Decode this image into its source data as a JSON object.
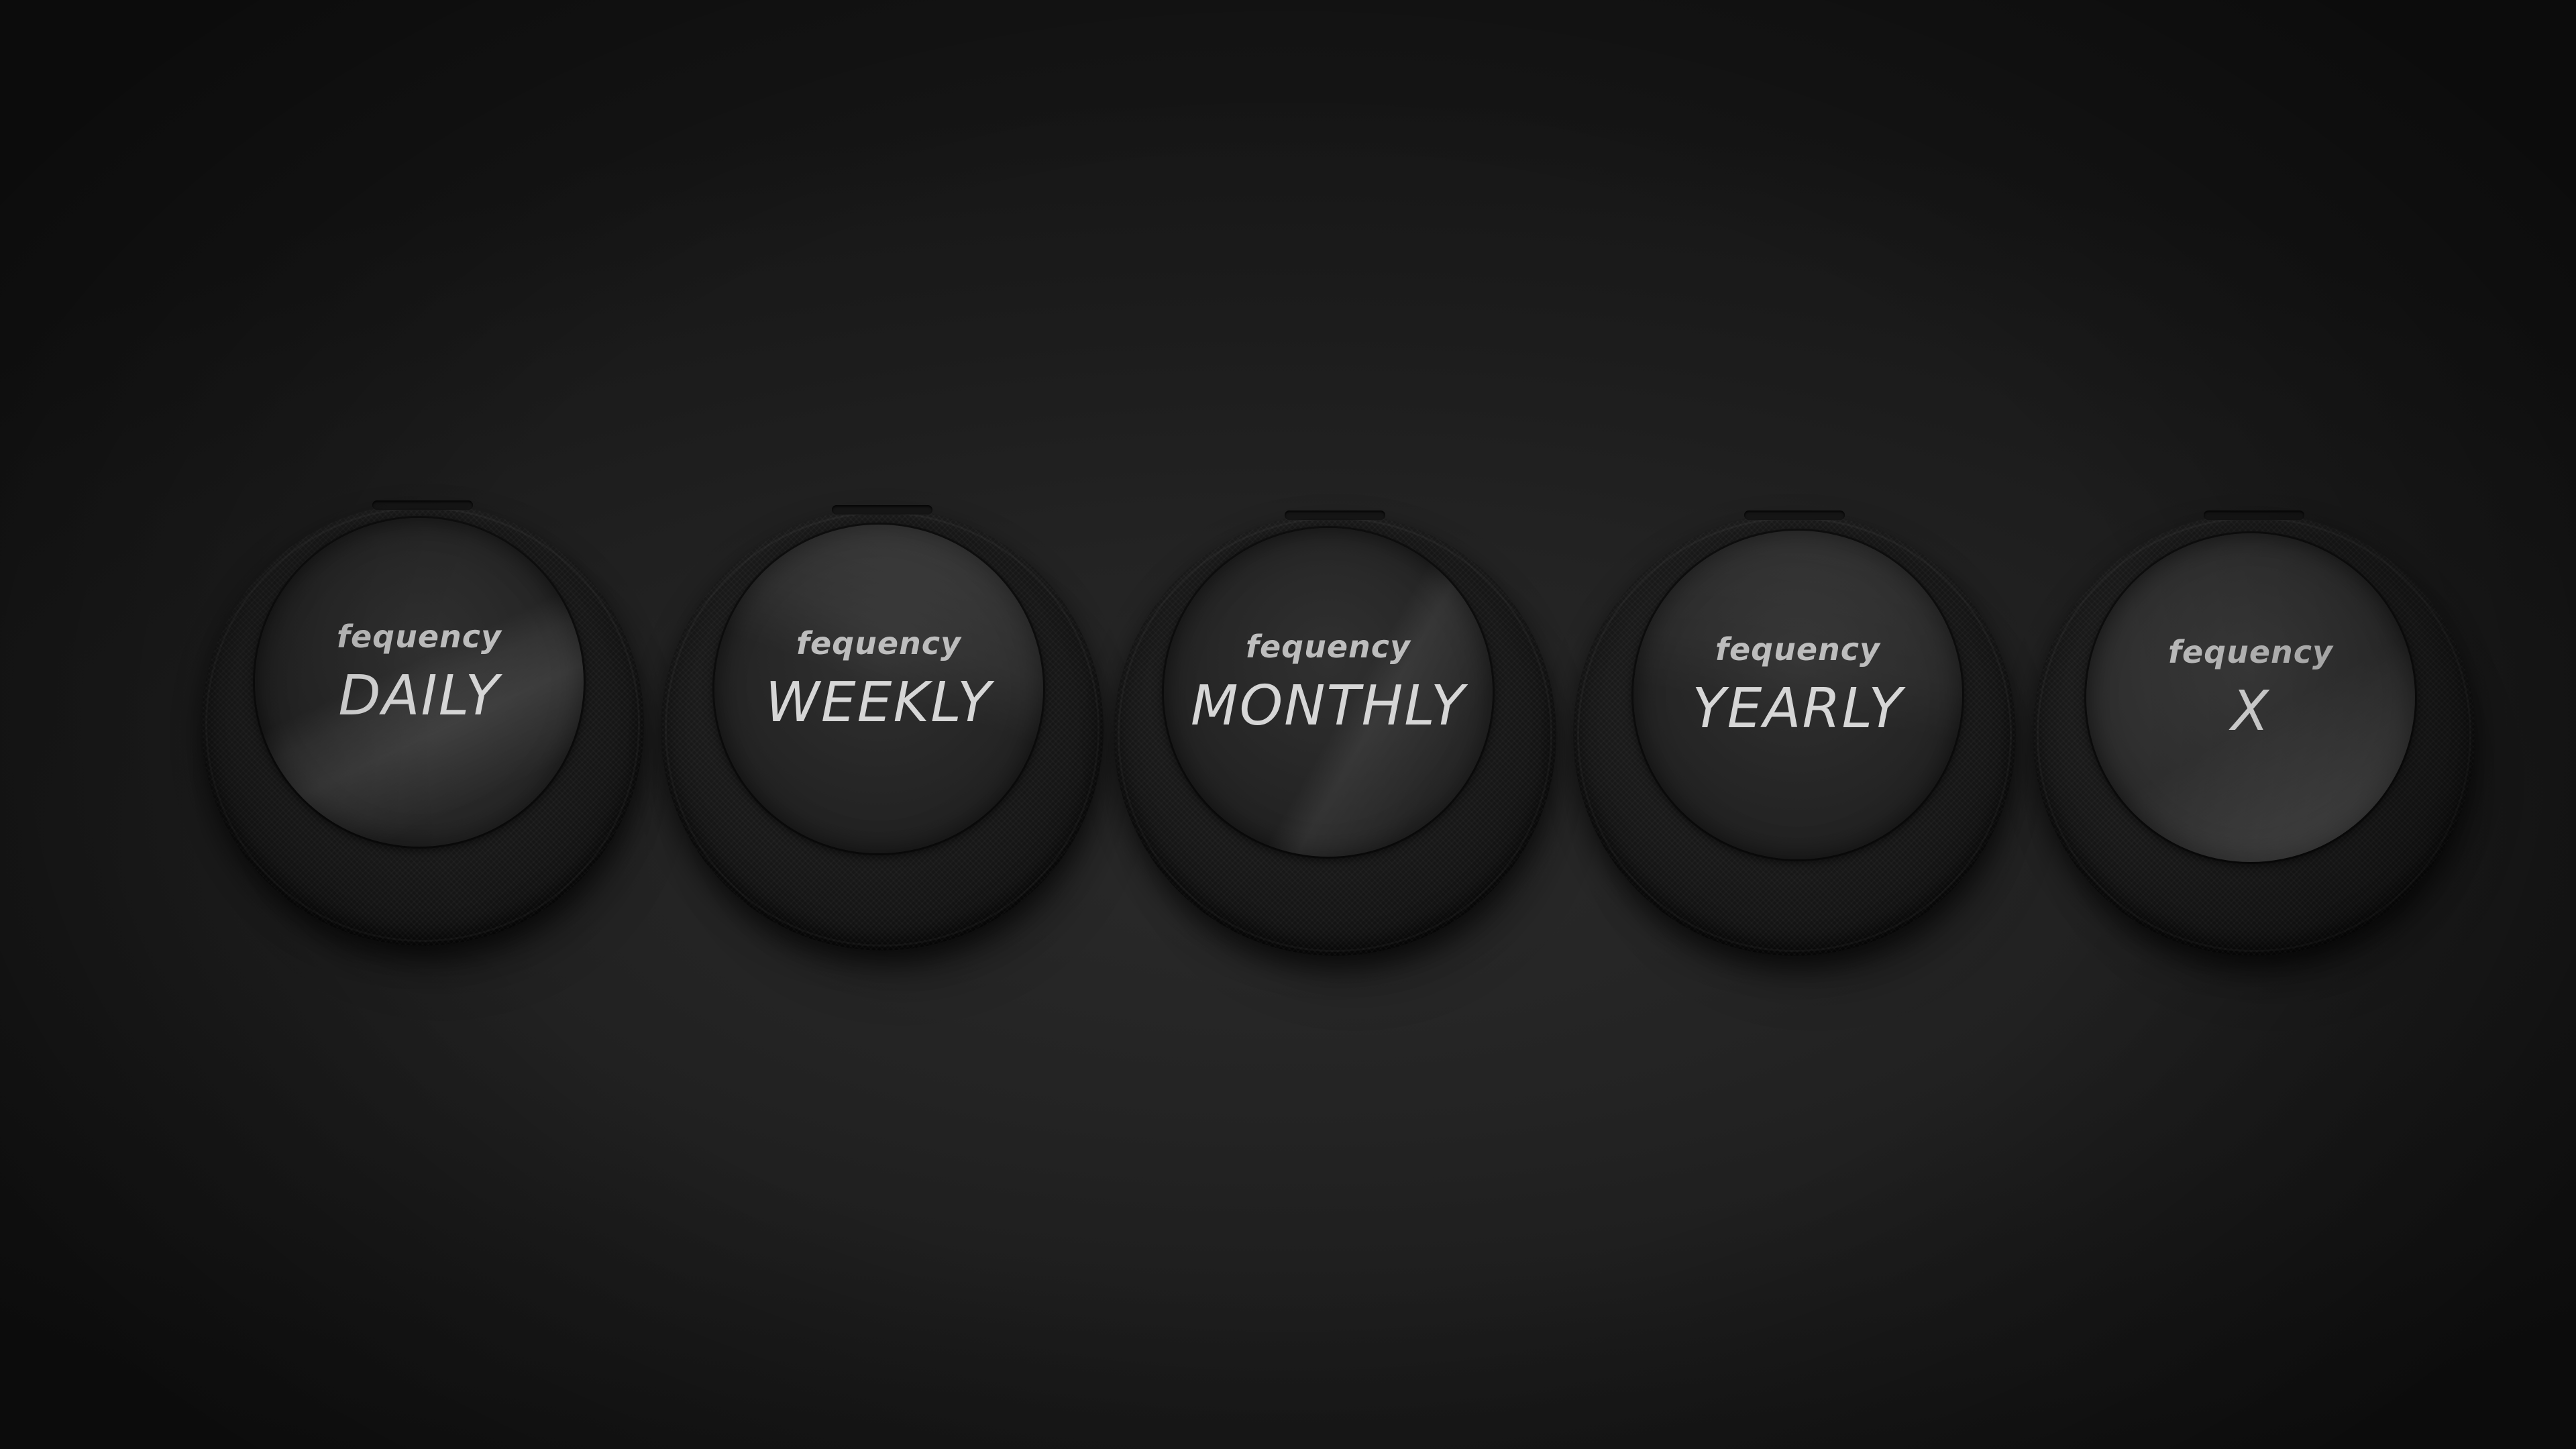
{
  "devices": [
    {
      "brand": "fequency",
      "mode": "DAILY"
    },
    {
      "brand": "fequency",
      "mode": "WEEKLY"
    },
    {
      "brand": "fequency",
      "mode": "MONTHLY"
    },
    {
      "brand": "fequency",
      "mode": "YEARLY"
    },
    {
      "brand": "fequency",
      "mode": "X"
    }
  ],
  "colors": {
    "background": "#1f1f1f",
    "device_body": "#141414",
    "screen": "#2a2a2a",
    "text": "#d0d0d0"
  }
}
